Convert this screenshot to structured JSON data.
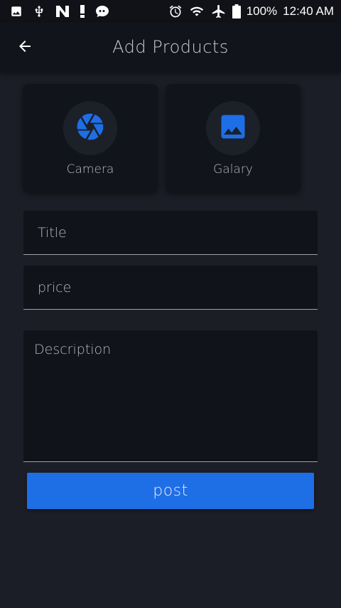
{
  "status_bar": {
    "left_icons": [
      "image-icon",
      "usb-icon",
      "n-app-icon",
      "alert-icon",
      "chat-icon"
    ],
    "right_icons": [
      "alarm-icon",
      "wifi-icon",
      "airplane-icon",
      "battery-icon"
    ],
    "battery": "100%",
    "time": "12:40 AM"
  },
  "app_bar": {
    "back_icon": "arrow-left-icon",
    "title": "Add Products"
  },
  "media": {
    "camera": {
      "label": "Camera",
      "icon": "camera-aperture-icon"
    },
    "gallery": {
      "label": "Galary",
      "icon": "image-icon"
    }
  },
  "form": {
    "title": {
      "value": "",
      "placeholder": "Title"
    },
    "price": {
      "value": "",
      "placeholder": "price"
    },
    "description": {
      "value": "",
      "placeholder": "Description"
    }
  },
  "post_button": {
    "label": "post"
  },
  "colors": {
    "accent": "#1e6ee6",
    "background": "#1b1e27",
    "surface": "#12141b",
    "status_bar": "#101217"
  }
}
